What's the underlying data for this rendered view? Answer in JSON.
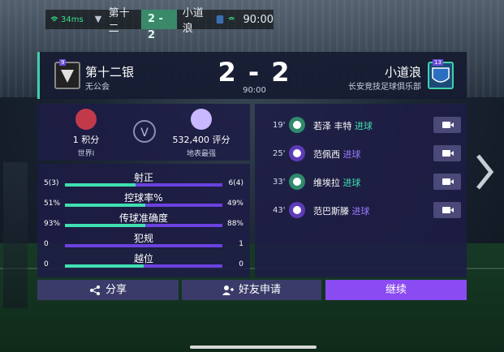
{
  "topbar": {
    "ping": "34ms",
    "home": "第十二",
    "score": "2 - 2",
    "away": "小道浪",
    "time": "90:00"
  },
  "header": {
    "home_name": "第十二银",
    "home_sub": "无公会",
    "home_badge_level": "9",
    "score": "2 - 2",
    "time": "90:00",
    "away_name": "小道浪",
    "away_sub": "长安竞技足球俱乐部",
    "away_badge_level": "13"
  },
  "rating": {
    "home_points": "1 积分",
    "home_label": "世界I",
    "vs": "V",
    "away_points": "532,400 评分",
    "away_label": "地表最强"
  },
  "stats": [
    {
      "name": "射正",
      "left": "5(3)",
      "right": "6(4)",
      "home_share": 0.45
    },
    {
      "name": "控球率%",
      "left": "51%",
      "right": "49%",
      "home_share": 0.51
    },
    {
      "name": "传球准确度",
      "left": "93%",
      "right": "88%",
      "home_share": 0.51
    },
    {
      "name": "犯规",
      "left": "0",
      "right": "1",
      "home_share": 0.0
    },
    {
      "name": "越位",
      "left": "0",
      "right": "0",
      "home_share": 0.5
    }
  ],
  "events": [
    {
      "minute": "19'",
      "player": "若泽 丰特",
      "type": "进球",
      "side": "home"
    },
    {
      "minute": "25'",
      "player": "范佩西",
      "type": "进球",
      "side": "away"
    },
    {
      "minute": "33'",
      "player": "维埃拉",
      "type": "进球",
      "side": "home"
    },
    {
      "minute": "43'",
      "player": "范巴斯滕",
      "type": "进球",
      "side": "away"
    }
  ],
  "buttons": {
    "share": "分享",
    "friend": "好友申请",
    "continue": "继续"
  },
  "colors": {
    "accent_green": "#3fe0b0",
    "accent_purple": "#8a4bf2"
  }
}
